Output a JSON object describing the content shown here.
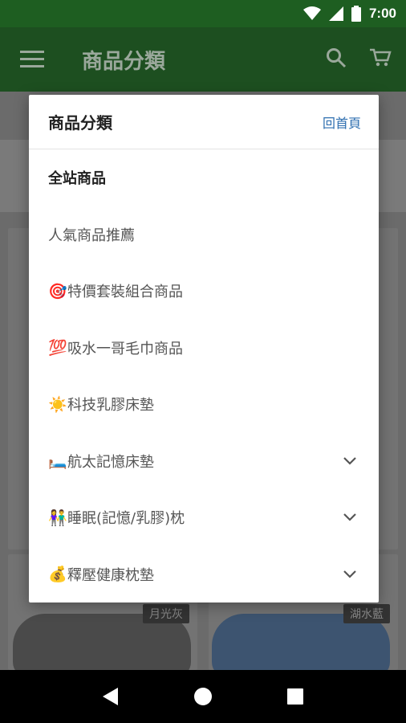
{
  "status_bar": {
    "time": "7:00"
  },
  "app_bar": {
    "title": "商品分類"
  },
  "background": {
    "tag_left": "月光灰",
    "tag_right": "湖水藍"
  },
  "dialog": {
    "title": "商品分類",
    "home_link": "回首頁",
    "items": [
      {
        "emoji": "",
        "label": "全站商品",
        "bold": true,
        "expandable": false
      },
      {
        "emoji": "",
        "label": "人氣商品推薦",
        "bold": false,
        "expandable": false
      },
      {
        "emoji": "🎯",
        "label": "特價套裝組合商品",
        "bold": false,
        "expandable": false
      },
      {
        "emoji": "💯",
        "label": "吸水一哥毛巾商品",
        "bold": false,
        "expandable": false
      },
      {
        "emoji": "☀️",
        "label": "科技乳膠床墊",
        "bold": false,
        "expandable": false
      },
      {
        "emoji": "🛏️",
        "label": "航太記憶床墊",
        "bold": false,
        "expandable": true
      },
      {
        "emoji": "👫",
        "label": "睡眠(記憶/乳膠)枕",
        "bold": false,
        "expandable": true
      },
      {
        "emoji": "💰",
        "label": "釋壓健康枕墊",
        "bold": false,
        "expandable": true
      }
    ]
  }
}
